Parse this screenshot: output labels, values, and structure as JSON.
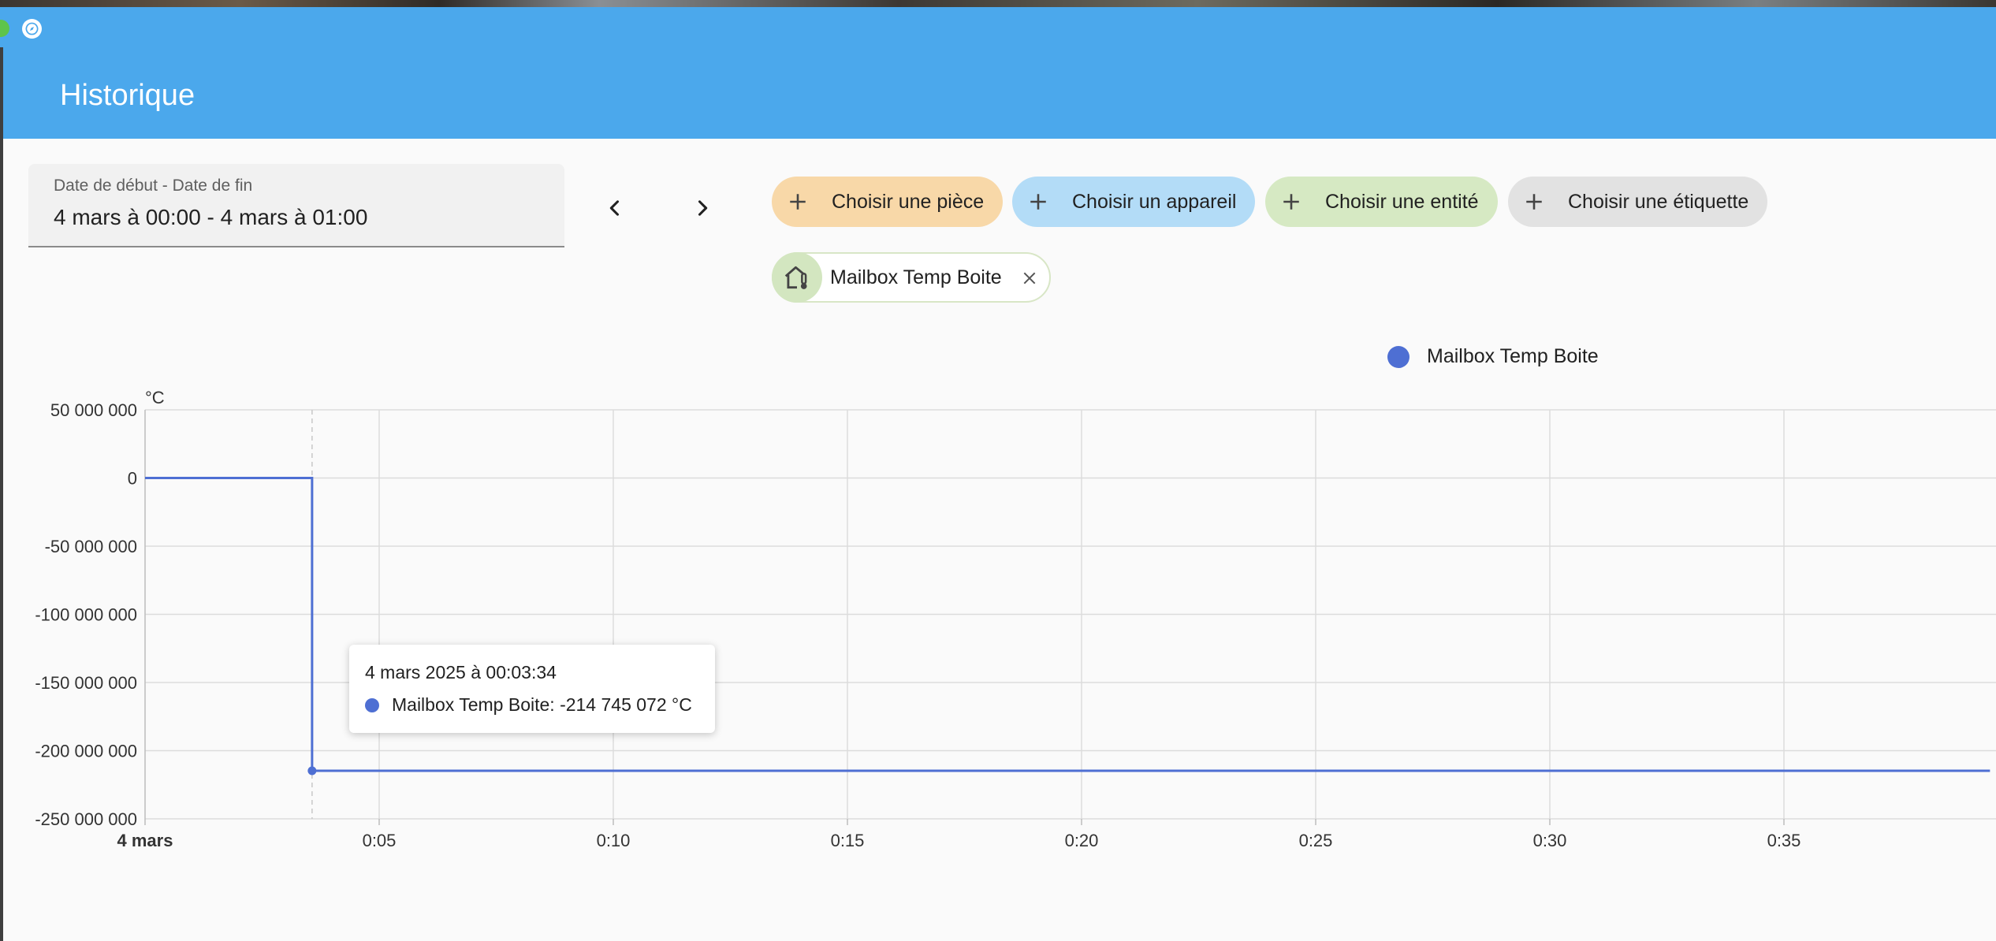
{
  "header": {
    "title": "Historique"
  },
  "date_range": {
    "label": "Date de début - Date de fin",
    "value": "4 mars à 00:00 - 4 mars à 01:00"
  },
  "pickers": [
    {
      "label": "Choisir une pièce",
      "color": "#f8d8a8"
    },
    {
      "label": "Choisir un appareil",
      "color": "#b3dcf7"
    },
    {
      "label": "Choisir une entité",
      "color": "#d6e9c3"
    },
    {
      "label": "Choisir une étiquette",
      "color": "#e2e2e2"
    }
  ],
  "selected_entity": {
    "label": "Mailbox Temp Boite"
  },
  "chart_data": {
    "type": "line",
    "step": true,
    "unit_label": "°C",
    "legend_position": "top-center",
    "grid": true,
    "y_ticks": [
      "50 000 000",
      "0",
      "-50 000 000",
      "-100 000 000",
      "-150 000 000",
      "-200 000 000",
      "-250 000 000"
    ],
    "ylim": [
      -250000000,
      50000000
    ],
    "x_ticks": [
      "4 mars",
      "0:05",
      "0:10",
      "0:15",
      "0:20",
      "0:25",
      "0:30",
      "0:35"
    ],
    "xlim_minutes": [
      0,
      39.4
    ],
    "series": [
      {
        "name": "Mailbox Temp Boite",
        "color": "#4e6fd3",
        "points": [
          [
            0,
            0
          ],
          [
            3.567,
            0
          ],
          [
            3.567,
            -214745072
          ],
          [
            39.4,
            -214745072
          ]
        ]
      }
    ],
    "tooltip": {
      "date": "4 mars 2025 à 00:03:34",
      "text": "Mailbox Temp Boite: -214 745 072 °C",
      "x_minutes": 3.567,
      "y": -214745072
    }
  }
}
